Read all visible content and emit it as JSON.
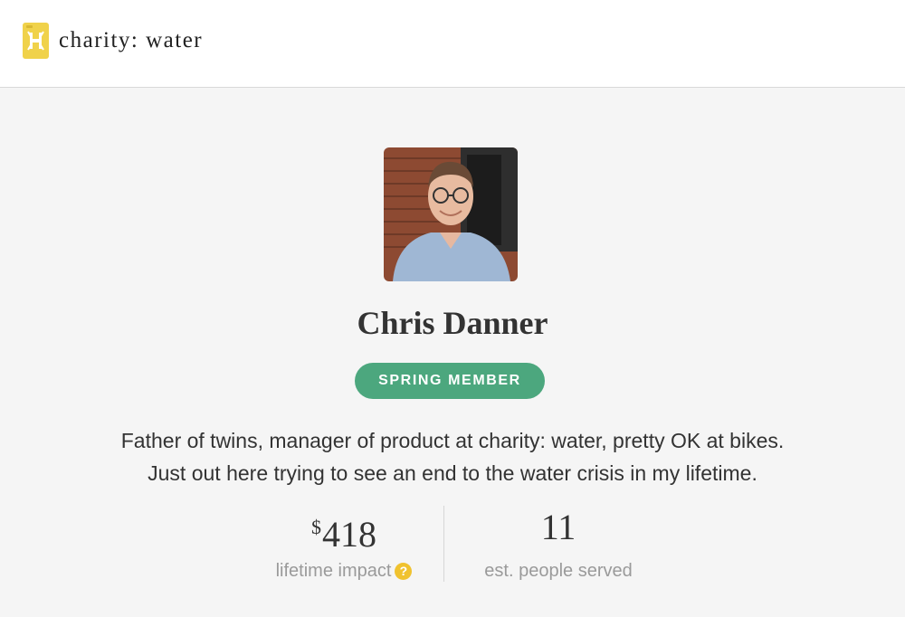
{
  "header": {
    "logo_text": "charity: water",
    "brand_color": "#f0d24a"
  },
  "profile": {
    "name": "Chris Danner",
    "badge": "SPRING MEMBER",
    "badge_color": "#4ca77e",
    "bio_lines": [
      "Father of twins, manager of product at charity: water, pretty OK at bikes.",
      "Just out here trying to see an end to the water crisis in my lifetime."
    ]
  },
  "stats": {
    "impact": {
      "currency": "$",
      "value": "418",
      "label": "lifetime impact",
      "icon": "help-icon",
      "icon_glyph": "?"
    },
    "people": {
      "value": "11",
      "label": "est. people served"
    }
  }
}
